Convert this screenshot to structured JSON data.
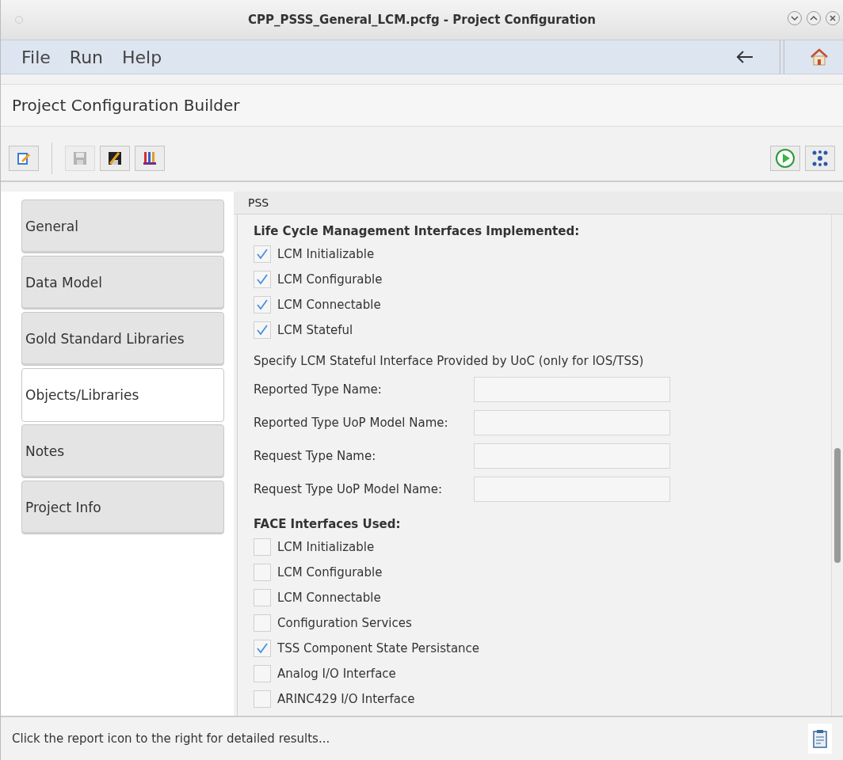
{
  "window": {
    "title": "CPP_PSSS_General_LCM.pcfg - Project Configuration"
  },
  "menu": [
    "File",
    "Run",
    "Help"
  ],
  "header": {
    "title": "Project Configuration Builder"
  },
  "sidebar": {
    "items": [
      {
        "label": "General",
        "selected": false
      },
      {
        "label": "Data Model",
        "selected": false
      },
      {
        "label": "Gold Standard Libraries",
        "selected": false
      },
      {
        "label": "Objects/Libraries",
        "selected": true
      },
      {
        "label": "Notes",
        "selected": false
      },
      {
        "label": "Project Info",
        "selected": false
      }
    ]
  },
  "panel": {
    "title": "PSS",
    "sections": [
      {
        "kind": "checks",
        "heading": "Life Cycle Management Interfaces Implemented:",
        "items": [
          {
            "label": "LCM Initializable",
            "checked": true
          },
          {
            "label": "LCM Configurable",
            "checked": true
          },
          {
            "label": "LCM Connectable",
            "checked": true
          },
          {
            "label": "LCM Stateful",
            "checked": true
          }
        ]
      },
      {
        "kind": "fields",
        "heading": "Specify LCM Stateful Interface Provided by UoC (only for IOS/TSS)",
        "items": [
          {
            "label": "Reported Type Name:"
          },
          {
            "label": "Reported Type UoP Model Name:"
          },
          {
            "label": "Request Type Name:"
          },
          {
            "label": "Request Type UoP Model Name:"
          }
        ]
      },
      {
        "kind": "checks",
        "heading": "FACE Interfaces Used:",
        "items": [
          {
            "label": "LCM Initializable",
            "checked": false
          },
          {
            "label": "LCM Configurable",
            "checked": false
          },
          {
            "label": "LCM Connectable",
            "checked": false
          },
          {
            "label": "Configuration Services",
            "checked": false
          },
          {
            "label": "TSS Component State Persistance",
            "checked": true
          },
          {
            "label": "Analog I/O Interface",
            "checked": false
          },
          {
            "label": "ARINC429 I/O Interface",
            "checked": false
          }
        ]
      }
    ]
  },
  "status_bar": {
    "text": "Click the report icon to the right for detailed results..."
  }
}
